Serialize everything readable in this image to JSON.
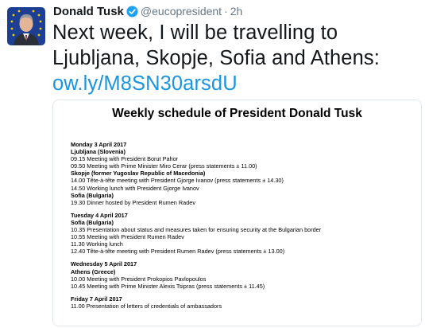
{
  "tweet": {
    "author_name": "Donald Tusk",
    "handle": "@eucopresident",
    "separator": "·",
    "time": "2h",
    "text_line1": "Next week, I will be travelling to",
    "text_line2": "Ljubljana, Skopje, Sofia and Athens:",
    "link": "ow.ly/M8SN30arsdU",
    "verified_color": "#1da1f2"
  },
  "document": {
    "title": "Weekly schedule of President Donald Tusk",
    "days": [
      {
        "date": "Monday 3 April 2017",
        "lines": [
          {
            "text": "Ljubljana (Slovenia)",
            "bold": true
          },
          {
            "text": "09.15 Meeting with President Borut Pahor",
            "bold": false
          },
          {
            "text": "09.50 Meeting with Prime Minister Miro Cerar (press statements ± 11.00)",
            "bold": false
          },
          {
            "text": "Skopje (former Yugoslav Republic of Macedonia)",
            "bold": true
          },
          {
            "text": "14.00 Tête-à-tête meeting with President Gjorge Ivanov (press statements ± 14.30)",
            "bold": false
          },
          {
            "text": "14.50 Working lunch with President Gjorge Ivanov",
            "bold": false
          },
          {
            "text": "Sofia (Bulgaria)",
            "bold": true
          },
          {
            "text": "19.30 Dinner hosted by President Rumen Radev",
            "bold": false
          }
        ]
      },
      {
        "date": "Tuesday 4 April 2017",
        "lines": [
          {
            "text": "Sofia (Bulgaria)",
            "bold": true
          },
          {
            "text": "10.35 Presentation about status and measures taken for ensuring security at the Bulgarian border",
            "bold": false
          },
          {
            "text": "10.55 Meeting with President Rumen Radev",
            "bold": false
          },
          {
            "text": "11.30 Working lunch",
            "bold": false
          },
          {
            "text": "12.40 Tête-à-tête meeting with President Rumen Radev  (press statements ± 13.00)",
            "bold": false
          }
        ]
      },
      {
        "date": "Wednesday 5 April 2017",
        "lines": [
          {
            "text": "Athens (Greece)",
            "bold": true
          },
          {
            "text": "10.00 Meeting with President Prokopios Pavlopoulos",
            "bold": false
          },
          {
            "text": "10.45 Meeting with Prime Minister Alexis Tsipras (press statements ± 11.45)",
            "bold": false
          }
        ]
      },
      {
        "date": "Friday 7 April 2017",
        "lines": [
          {
            "text": "11.00 Presentation of letters of credentials of ambassadors",
            "bold": false
          }
        ]
      }
    ]
  }
}
